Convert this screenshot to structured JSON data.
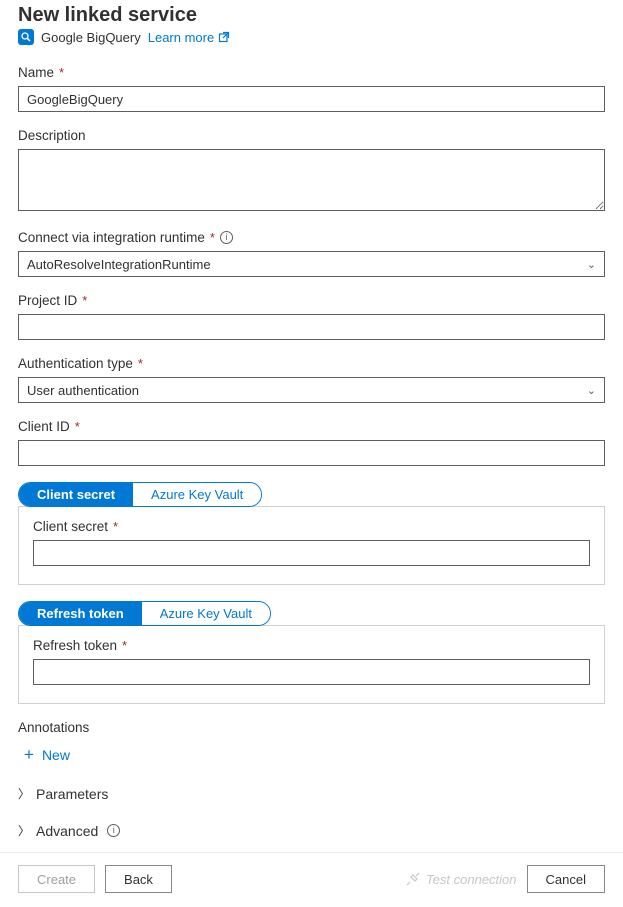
{
  "header": {
    "title": "New linked service",
    "service_name": "Google BigQuery",
    "learn_more": "Learn more"
  },
  "form": {
    "name": {
      "label": "Name",
      "value": "GoogleBigQuery"
    },
    "description": {
      "label": "Description",
      "value": ""
    },
    "integration_runtime": {
      "label": "Connect via integration runtime",
      "value": "AutoResolveIntegrationRuntime"
    },
    "project_id": {
      "label": "Project ID",
      "value": ""
    },
    "auth_type": {
      "label": "Authentication type",
      "value": "User authentication"
    },
    "client_id": {
      "label": "Client ID",
      "value": ""
    },
    "client_secret_toggle": {
      "active": "Client secret",
      "inactive": "Azure Key Vault"
    },
    "client_secret": {
      "label": "Client secret",
      "value": ""
    },
    "refresh_token_toggle": {
      "active": "Refresh token",
      "inactive": "Azure Key Vault"
    },
    "refresh_token": {
      "label": "Refresh token",
      "value": ""
    },
    "annotations": {
      "label": "Annotations",
      "new_label": "New"
    },
    "parameters": {
      "label": "Parameters"
    },
    "advanced": {
      "label": "Advanced"
    }
  },
  "footer": {
    "create": "Create",
    "back": "Back",
    "test_connection": "Test connection",
    "cancel": "Cancel"
  }
}
